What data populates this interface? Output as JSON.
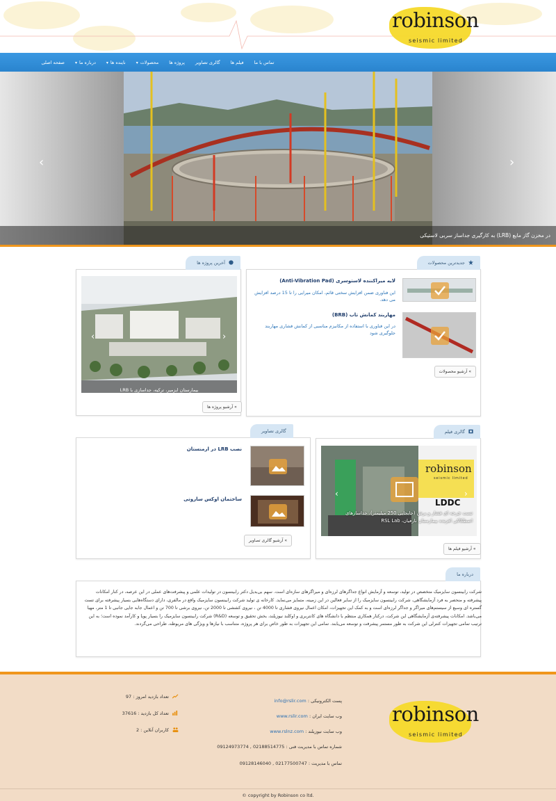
{
  "brand": {
    "name": "robinson",
    "tagline": "seismic limited"
  },
  "nav": {
    "items": [
      {
        "label": "صفحه اصلی"
      },
      {
        "label": "درباره ما",
        "has_dropdown": true
      },
      {
        "label": "ناینده ها",
        "has_dropdown": true
      },
      {
        "label": "محصولات",
        "has_dropdown": true
      },
      {
        "label": "پروژه ها"
      },
      {
        "label": "گالری تصاویر"
      },
      {
        "label": "فیلم ها"
      },
      {
        "label": "تماس با ما"
      }
    ]
  },
  "slider": {
    "caption": "به کارگیری جداساز سربی لاستیکی (LRB) در مخزن گاز مایع",
    "prev": "‹",
    "next": "›"
  },
  "products": {
    "tab": "جدیدترین محصولات",
    "items": [
      {
        "title": "لایه میراکننده لاستوسری (Anti-Vibration Pad)",
        "desc": "این فناوری ضمن افزایش سختی قائم، امکان میرایی را تا 15 درصد افزایش می دهد."
      },
      {
        "title": "مهاربند کمانش تاب (BRB)",
        "desc": "در این فناوری با استفاده از مکانیزم مناسبی از کمانش فشاری مهاربند جلوگیری شود"
      }
    ],
    "archive_button": "آرشیو محصولات"
  },
  "projects": {
    "tab": "آخرین پروژه ها",
    "caption": "بیمارستان ایزمیر، ترکیه، جداسازی با LRB",
    "archive_button": "آرشیو پروژه ها"
  },
  "videos": {
    "tab": "گالری فیلم",
    "caption": "تست چرخه ای فشار و برش (جابجایی 250 میلیمتر)، جداسازهای اصطکاکی افزنده بیمارستان نارفیان، RSL Lab",
    "overlay_brand": "robinson",
    "overlay_sub": "seismic limited",
    "overlay_code": "LDDC",
    "archive_button": "آرشیو فیلم ها"
  },
  "gallery": {
    "tab": "گالری تصاویر",
    "items": [
      {
        "title": "نصب LRB در ارمنستان"
      },
      {
        "title": "ساختمان اوکس ساروتی"
      }
    ],
    "archive_button": "آرشیو گالری تصاویر"
  },
  "about": {
    "tab": "درباره ما",
    "text": "شرکت رابینسون سایزمیک متخصص در تولید، توسعه و آزمایش انواع جداگرهای لرزه‌ای و میراگرهای سازه‌ای است. سهم بی‌بدیل دکتر رابینسون در تولیدات علمی و پیشرفت‌های عملی در این عرصه، در کنار امکانات پیشرفته و منحصر به فرد آزمایشگاهی، شرکت رابینسون سایزمیک را از سایر فعالین در این زمینه، متمایز می‌نماید. کارخانه ی تولید شرکت رابینسون سایزمیک واقع در مالفری، دارای دستگاه‌هایی بسیار پیشرفته برای تست گستره ای وسیع از سیستم‌های میراگر و جداگر لرزه‌ای است و به کمک این تجهیزات، امکان اعمال نیروی فشاری تا 4000 تن ، نیروی کششی تا 2000 تن، نیروی برشی تا 700 تن و اعمال جابه جایی جانبی تا 1 متر، مهیا می‌باشد. امکانات پیشرفته‌ی آزمایشگاهی این شرکت، درکنار همکاری منتظم با دانشگاه های کانتربری و اوکلند نیوزیلند، بخش تحقیق و توسعه (R&D) شرکت رابینسون سایزمیک را بسیار پویا و کارآمد نموده است؛ به این ترتیب تمامی تجهیزات کنترلی این شرکت به طور مستمر پیشرفت و توسعه می‌یابند. تمامی این تجهیزات به طور خاص برای هر پروژه، متناسب با نیازها و ویژگی های مربوطه، طراحی می‌گردند."
  },
  "footer": {
    "email_label": "پست الکترونیکی :",
    "email": "info@rslir.com",
    "site_iran_label": "وب سایت ایران :",
    "site_iran": "www.rslir.com",
    "site_nz_label": "وب سایت نیوزیلند :",
    "site_nz": "www.rslnz.com",
    "phone_tech": "شماره تماس با مدیریت فنی : 02188514775 , 09124973774",
    "phone_manager": "تماس با مدیریت : 02177500747 , 09128146040",
    "stats": [
      {
        "label": "تعداد بازدید امروز :",
        "value": "97",
        "icon": "chart-line-icon"
      },
      {
        "label": "تعداد کل بازدید :",
        "value": "37616",
        "icon": "bar-chart-icon"
      },
      {
        "label": "کاربران آنلاین :",
        "value": "2",
        "icon": "users-icon"
      }
    ],
    "copyright": "© copyright by Robinson co ltd."
  },
  "colors": {
    "nav": "#2c8bd6",
    "accent": "#f0961c",
    "footer": "#f2dcc6",
    "tab": "#d6e6f4"
  }
}
